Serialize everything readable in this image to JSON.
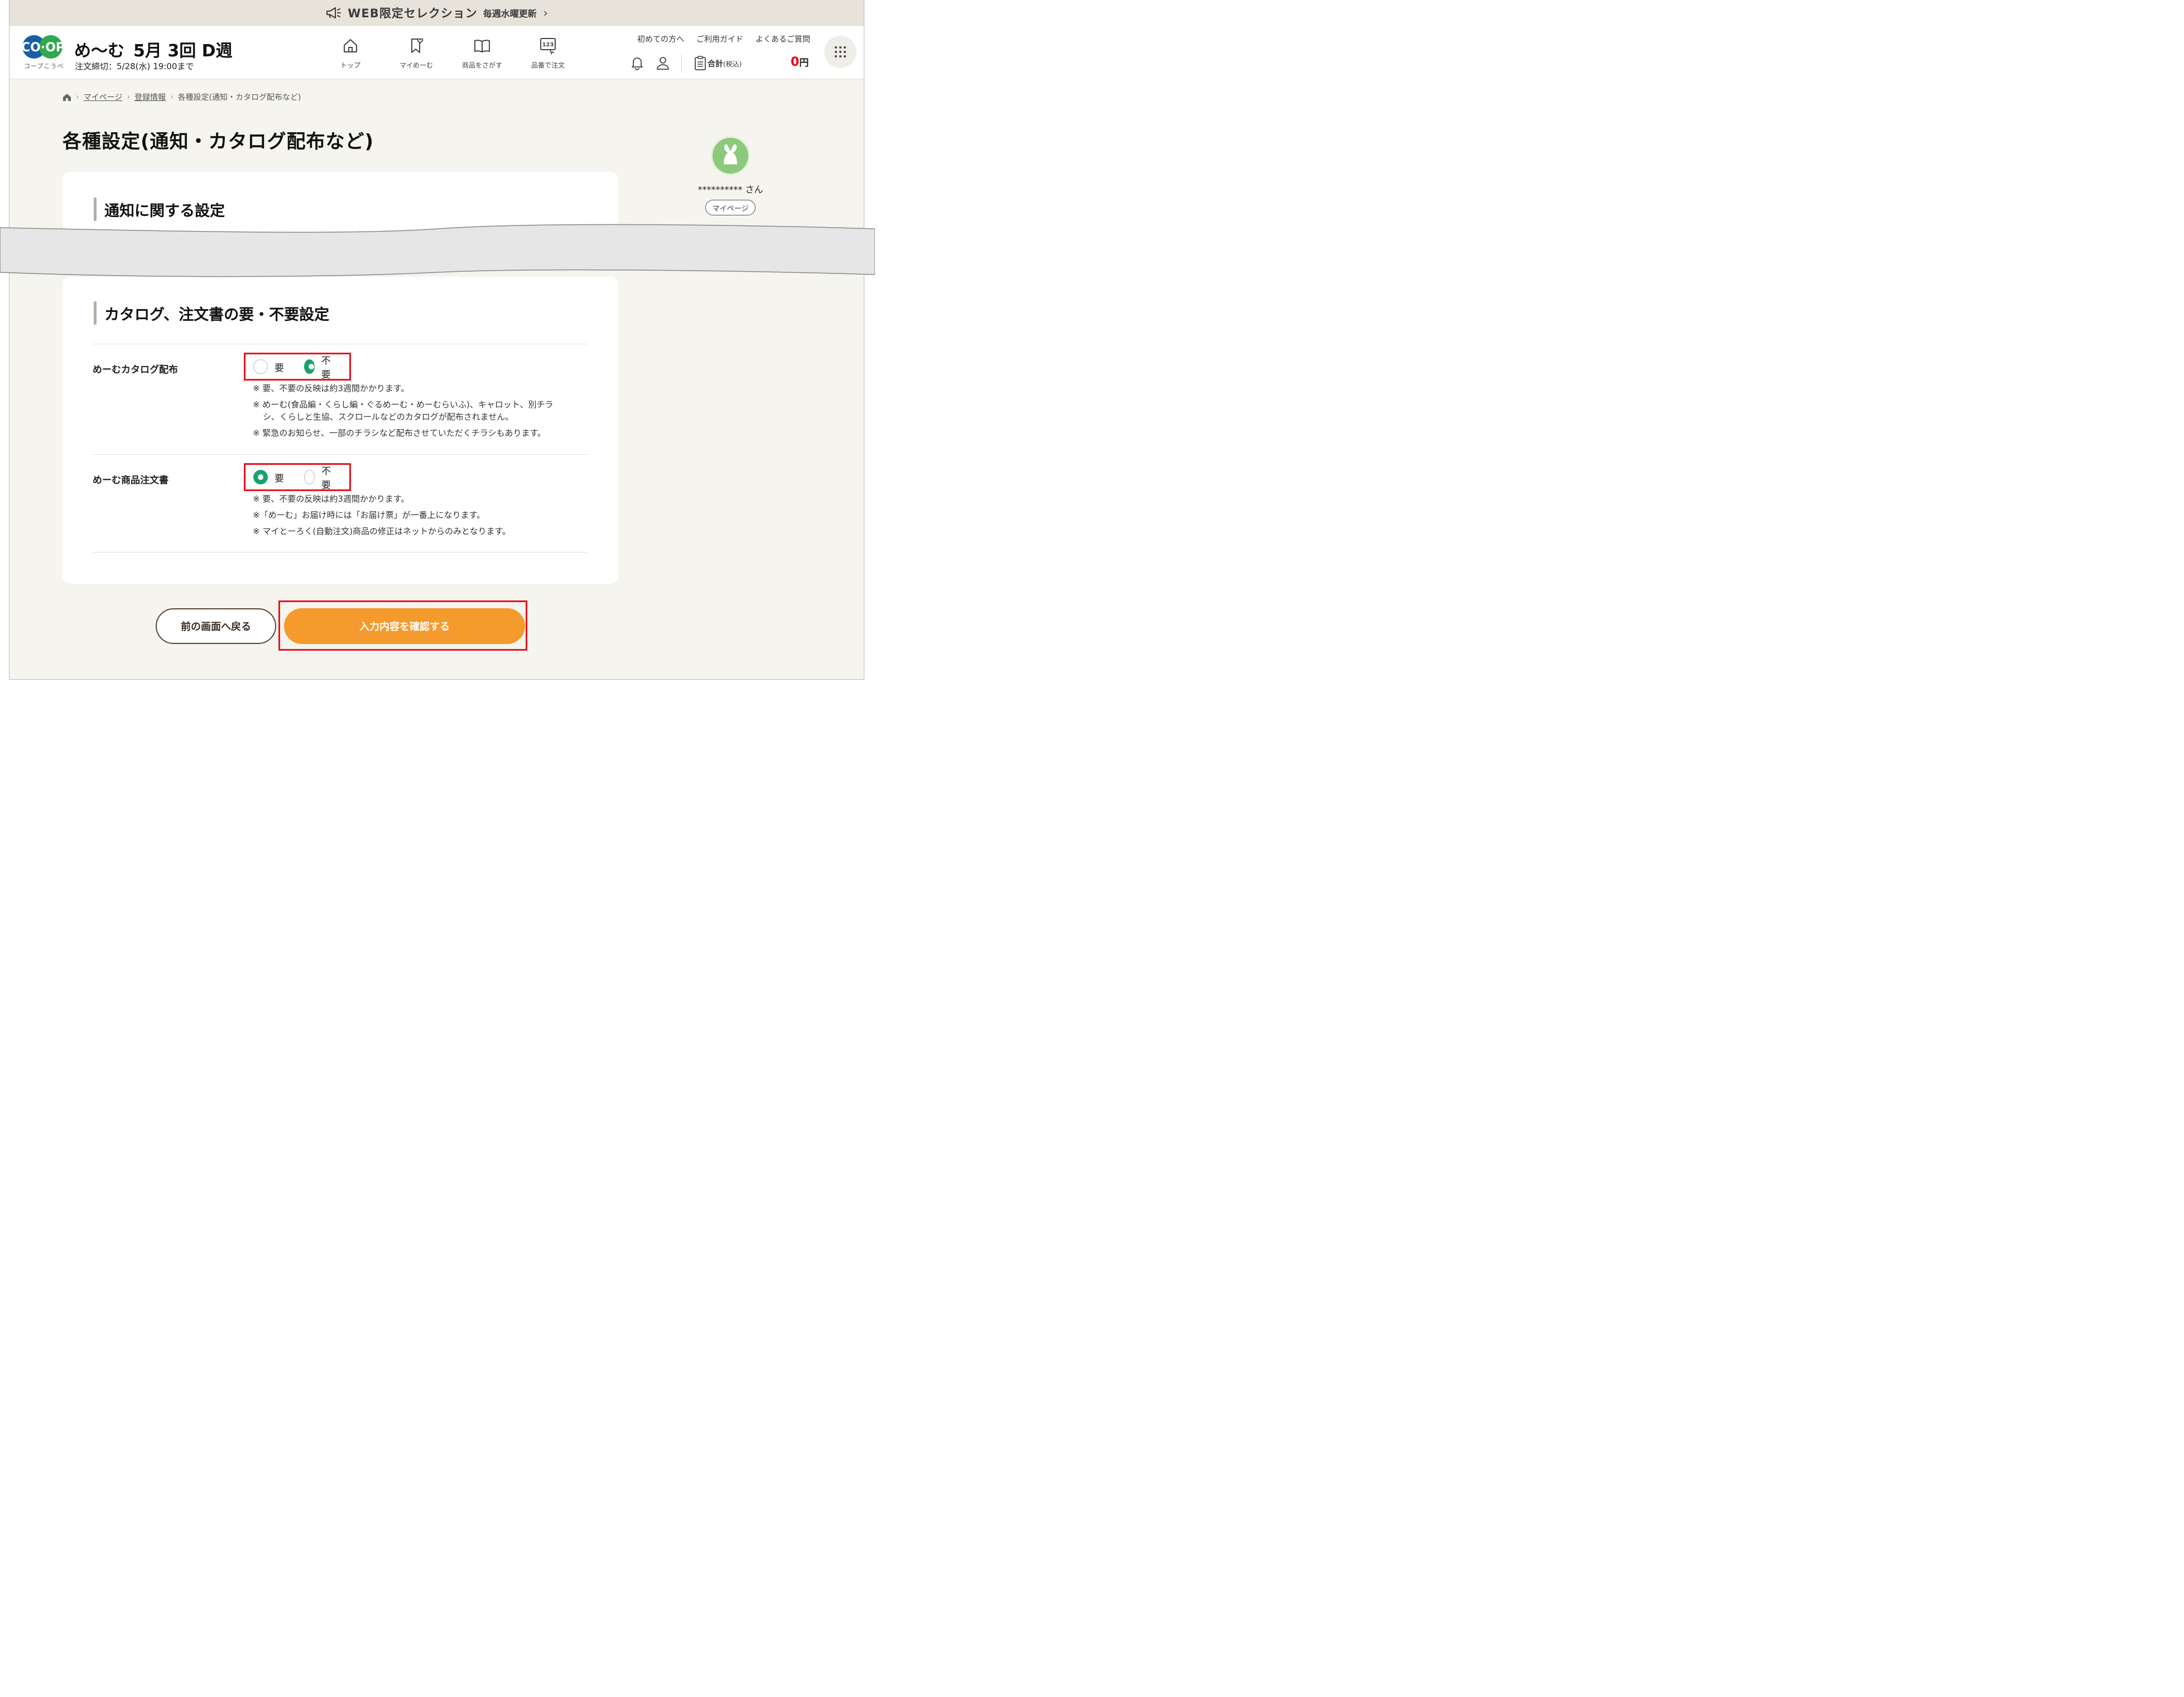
{
  "promo": {
    "icon": "megaphone-icon",
    "title": "WEB限定セレクション",
    "sub": "毎週水曜更新",
    "chevron": "›"
  },
  "header": {
    "logo_text": "CO·OP",
    "logo_sub": "コープこうべ",
    "brand": "め～む",
    "week": "5月 3回 D週",
    "deadline": "注文締切：5/28(水) 19:00まで",
    "nav": [
      {
        "label": "トップ",
        "icon": "home-icon"
      },
      {
        "label": "マイめーむ",
        "icon": "bookmark-heart-icon"
      },
      {
        "label": "商品をさがす",
        "icon": "book-icon"
      },
      {
        "label": "品番で注文",
        "icon": "number-input-icon"
      }
    ],
    "links": [
      "初めての方へ",
      "ご利用ガイド",
      "よくあるご質問"
    ],
    "total_label": "合計",
    "total_tax": "(税込)",
    "total_value": "0",
    "total_unit": "円"
  },
  "breadcrumb": [
    "マイページ",
    "登録情報",
    "各種設定(通知・カタログ配布など)"
  ],
  "page_title": "各種設定(通知・カタログ配布など)",
  "profile": {
    "name": "**********",
    "suffix": "さん",
    "mypage_label": "マイページ"
  },
  "section_notify": {
    "title": "通知に関する設定"
  },
  "section_catalog": {
    "title": "カタログ、注文書の要・不要設定",
    "rows": [
      {
        "label": "めーむカタログ配布",
        "options": [
          "要",
          "不要"
        ],
        "selected": "不要",
        "notes": [
          "※ 要、不要の反映は約3週間かかります。",
          "※ めーむ(食品編・くらし編・ぐるめーむ・めーむらいふ)、キャロット、別チラシ、くらしと生協、スクロールなどのカタログが配布されません。",
          "※ 緊急のお知らせ、一部のチラシなど配布させていただくチラシもあります。"
        ]
      },
      {
        "label": "めーむ商品注文書",
        "options": [
          "要",
          "不要"
        ],
        "selected": "要",
        "notes": [
          "※ 要、不要の反映は約3週間かかります。",
          "※「めーむ」お届け時には「お届け票」が一番上になります。",
          "※ マイとーろく(自動注文)商品の修正はネットからのみとなります。"
        ]
      }
    ]
  },
  "buttons": {
    "back": "前の画面へ戻る",
    "confirm": "入力内容を確認する"
  },
  "colors": {
    "accent_orange": "#f59a2c",
    "radio_green": "#18a36d",
    "highlight_red": "#e8121e",
    "price_red": "#e60012"
  }
}
